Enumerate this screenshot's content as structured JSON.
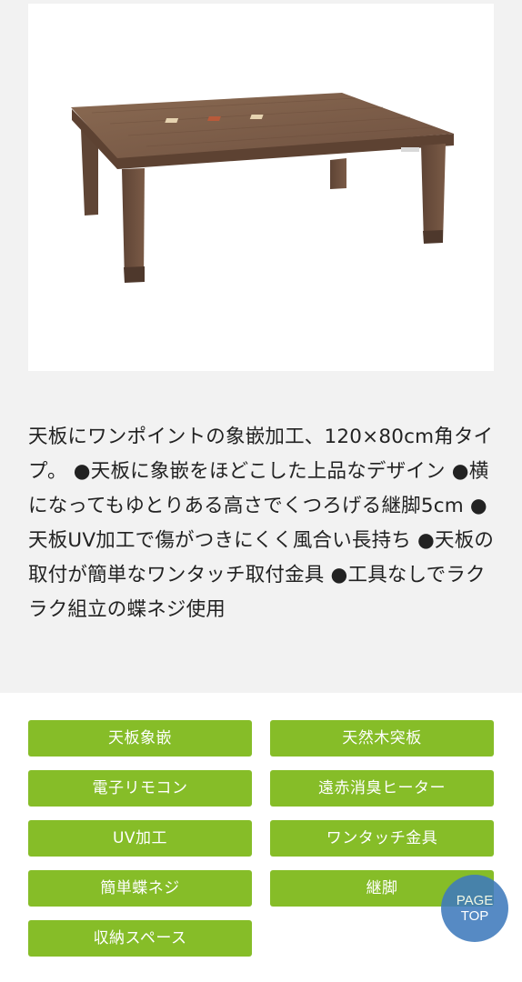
{
  "product_image": {
    "alt": "天板象嵌 こたつテーブル"
  },
  "description": "天板にワンポイントの象嵌加工、120×80cm角タイプ。 ●天板に象嵌をほどこした上品なデザイン ●横になってもゆとりある高さでくつろげる継脚5cm ●天板UV加工で傷がつきにくく風合い長持ち ●天板の取付が簡単なワンタッチ取付金具 ●工具なしでラクラク組立の蝶ネジ使用",
  "tags": [
    {
      "label": "天板象嵌"
    },
    {
      "label": "天然木突板"
    },
    {
      "label": "電子リモコン"
    },
    {
      "label": "遠赤消臭ヒーター"
    },
    {
      "label": "UV加工"
    },
    {
      "label": "ワンタッチ金具"
    },
    {
      "label": "簡単蝶ネジ"
    },
    {
      "label": "継脚"
    },
    {
      "label": "収納スペース"
    }
  ],
  "page_top": {
    "line1": "PAGE",
    "line2": "TOP"
  },
  "colors": {
    "background": "#f2f2f2",
    "tag_green": "#86bd28",
    "page_top_blue": "#3f7bbd",
    "text": "#222222",
    "wood": "#7a5a44"
  }
}
